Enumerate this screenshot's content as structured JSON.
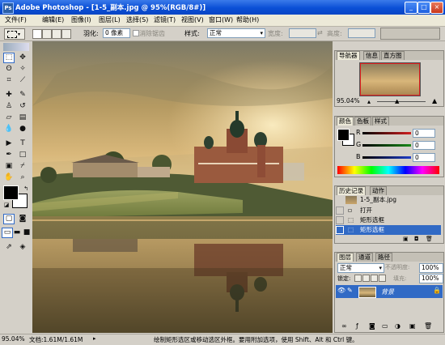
{
  "app": {
    "title": "Adobe Photoshop - [1-5_副本.jpg @ 95%(RGB/8#)]",
    "logo_text": "Ps",
    "window_buttons": [
      "_",
      "□",
      "×"
    ]
  },
  "menu": [
    "文件(F)",
    "编辑(E)",
    "图像(I)",
    "图层(L)",
    "选择(S)",
    "滤镜(T)",
    "视图(V)",
    "窗口(W)",
    "帮助(H)"
  ],
  "options": {
    "feather_label": "羽化:",
    "feather_value": "0 像素",
    "antialias_label": "消除锯齿",
    "style_label": "样式:",
    "style_value": "正常",
    "width_label": "宽度:",
    "height_label": "高度:"
  },
  "navigator": {
    "tabs": [
      "导航器",
      "信息",
      "直方图"
    ],
    "zoom": "95.04%"
  },
  "color": {
    "tabs": [
      "颜色",
      "色板",
      "样式"
    ],
    "channels": [
      {
        "label": "R",
        "value": "0",
        "color": "#d11f1f"
      },
      {
        "label": "G",
        "value": "0",
        "color": "#1a8a1a"
      },
      {
        "label": "B",
        "value": "0",
        "color": "#1e3cc8"
      }
    ]
  },
  "history": {
    "tabs": [
      "历史记录",
      "动作"
    ],
    "snapshot": "1-5_副本.jpg",
    "items": [
      "打开",
      "矩形选框",
      "矩形选框"
    ],
    "active_index": 2
  },
  "layers": {
    "tabs": [
      "图层",
      "通道",
      "路径"
    ],
    "blend_mode": "正常",
    "opacity_label": "不透明度:",
    "opacity_value": "100%",
    "lock_label": "锁定:",
    "fill_label": "填充:",
    "fill_value": "100%",
    "layer_name": "背景"
  },
  "status": {
    "zoom": "95.04%",
    "doc": "文档:1.61M/1.61M",
    "hint": "绘制矩形选区或移动选区外框。要用附加选项，使用 Shift、Alt 和 Ctrl 键。"
  },
  "colors": {
    "title_bar": "#0a4fd6",
    "selection": "#316ac5",
    "panel_bg": "#d4d0c8"
  }
}
